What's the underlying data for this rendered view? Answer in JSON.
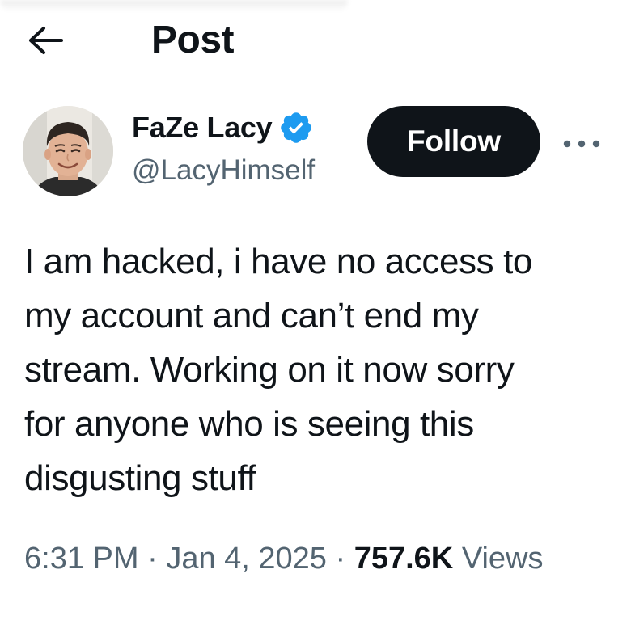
{
  "header": {
    "title": "Post",
    "back_icon": "arrow-left-icon"
  },
  "author": {
    "display_name": "FaZe Lacy",
    "handle": "@LacyHimself",
    "verified_icon": "verified-badge-icon",
    "verified_color": "#1d9bf0"
  },
  "actions": {
    "follow_label": "Follow",
    "more_icon": "more-horizontal-icon"
  },
  "post": {
    "text": "I am hacked, i have no access to\nmy account and can’t end my\nstream. Working on it now sorry\nfor anyone who is seeing this\ndisgusting stuff"
  },
  "meta": {
    "time": "6:31 PM",
    "separator": "·",
    "date": "Jan 4, 2025",
    "views_count": "757.6K",
    "views_label": "Views"
  },
  "colors": {
    "text_primary": "#0f1419",
    "text_secondary": "#536471",
    "follow_bg": "#0f1419",
    "divider": "#eff3f4"
  }
}
